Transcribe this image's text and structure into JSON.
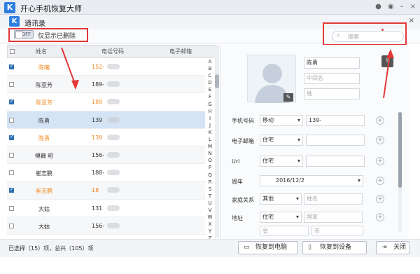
{
  "app": {
    "logo": "K",
    "title": "开心手机恢复大师",
    "sys_icons": [
      "wechat-icon",
      "chat-icon",
      "minimize-icon",
      "close-icon"
    ]
  },
  "window": {
    "logo": "K",
    "title": "通讯录",
    "close": "×"
  },
  "toolbar": {
    "toggle_text": "OFF",
    "toggle_label": "仅显示已删除",
    "search_placeholder": "搜索"
  },
  "columns": {
    "name": "姓名",
    "phone": "电话号码",
    "email": "电子邮箱"
  },
  "contacts": [
    {
      "name": "陈曦",
      "phone": "152-",
      "checked": true,
      "deleted": true
    },
    {
      "name": "陈亚芳",
      "phone": "189-",
      "checked": false,
      "deleted": false
    },
    {
      "name": "陈亚芳",
      "phone": "189",
      "checked": true,
      "deleted": true
    },
    {
      "name": "陈勇",
      "phone": "139",
      "checked": false,
      "deleted": false,
      "selected": true
    },
    {
      "name": "陈勇",
      "phone": "139",
      "checked": true,
      "deleted": true
    },
    {
      "name": "傅巍 昭",
      "phone": "156-",
      "checked": false,
      "deleted": false
    },
    {
      "name": "崔志鹏",
      "phone": "188-",
      "checked": false,
      "deleted": false
    },
    {
      "name": "崔志鹏",
      "phone": "18",
      "checked": true,
      "deleted": true
    },
    {
      "name": "大姑",
      "phone": "131",
      "checked": false,
      "deleted": false
    },
    {
      "name": "大姑",
      "phone": "156-",
      "checked": false,
      "deleted": false
    }
  ],
  "alphabet": [
    "A",
    "B",
    "C",
    "D",
    "E",
    "F",
    "G",
    "H",
    "I",
    "J",
    "K",
    "L",
    "M",
    "N",
    "O",
    "P",
    "Q",
    "R",
    "S",
    "T",
    "U",
    "V",
    "W",
    "X",
    "Y",
    "Z",
    "#"
  ],
  "detail": {
    "first_name": "陈勇",
    "middle_placeholder": "中间名",
    "last_placeholder": "姓",
    "phone_label": "手机号码",
    "phone_type": "移动",
    "phone_value": "139-",
    "email_label": "电子邮箱",
    "email_type": "住宅",
    "url_label": "Url",
    "url_type": "住宅",
    "anniv_label": "周年",
    "anniv_value": "2016/12/2",
    "family_label": "家庭关系",
    "family_type": "其他",
    "family_placeholder": "姓名",
    "address_label": "地址",
    "address_type": "住宅",
    "country_placeholder": "国家",
    "province_placeholder": "省",
    "city_placeholder": "市"
  },
  "footer": {
    "status": "已选择（15）项，总共（105）项",
    "restore_pc": "恢复到电脑",
    "restore_device": "恢复到设备",
    "close": "关闭"
  },
  "colors": {
    "accent": "#2f7fe0",
    "deleted": "#f08a24",
    "annotation": "#e23838",
    "selected_row": "#d5e4f5"
  }
}
